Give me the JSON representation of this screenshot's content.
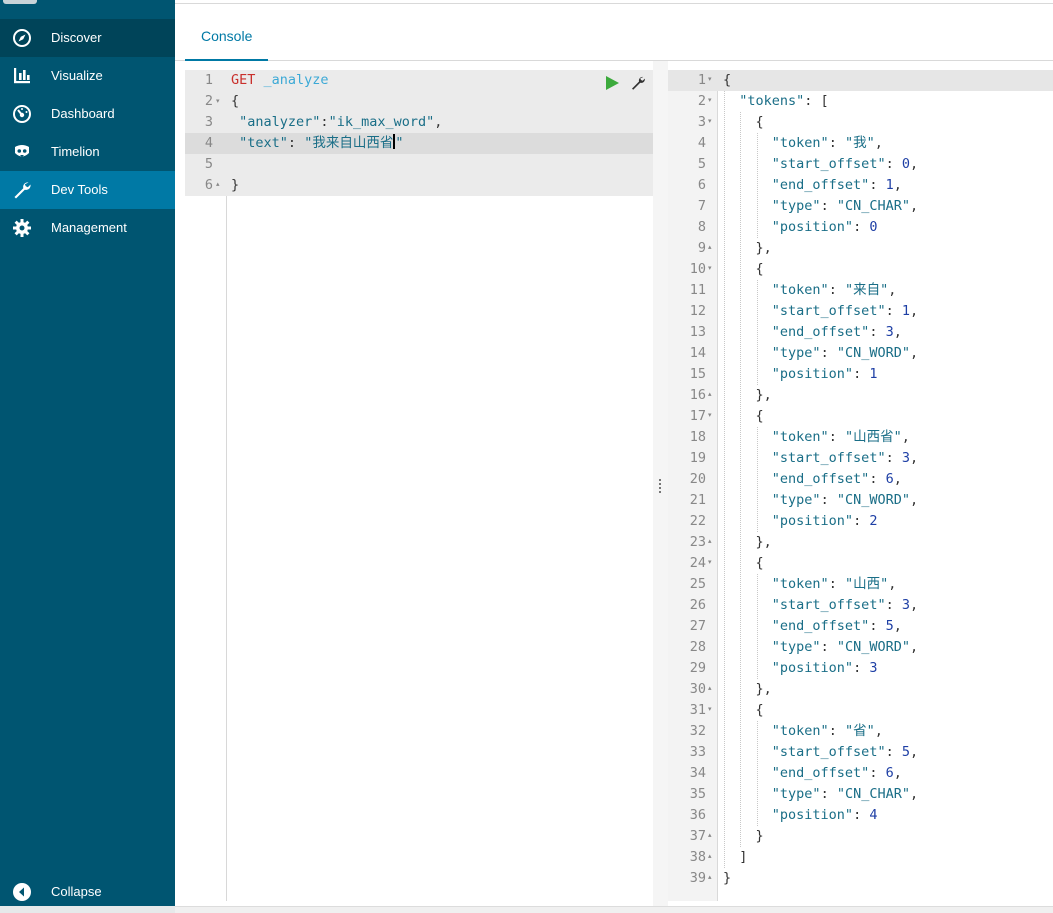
{
  "sidebar": {
    "items": [
      {
        "label": "Discover",
        "icon": "compass-icon"
      },
      {
        "label": "Visualize",
        "icon": "bar-chart-icon"
      },
      {
        "label": "Dashboard",
        "icon": "dashboard-gauge-icon"
      },
      {
        "label": "Timelion",
        "icon": "timelion-mask-icon"
      },
      {
        "label": "Dev Tools",
        "icon": "wrench-icon"
      },
      {
        "label": "Management",
        "icon": "gear-icon"
      }
    ],
    "collapse_label": "Collapse",
    "active_item": "Dev Tools",
    "colors": {
      "background": "#005571",
      "active": "#0079a5",
      "hover": "#004459"
    }
  },
  "tabs": {
    "console_label": "Console"
  },
  "request_editor": {
    "line_numbers": [
      "1",
      "2",
      "3",
      "4",
      "5",
      "6"
    ],
    "method": "GET",
    "url": "_analyze",
    "line2": "{",
    "line3_key": "\"analyzer\"",
    "line3_colon": ":",
    "line3_value": "\"ik_max_word\"",
    "line3_comma": ",",
    "line4_key": "\"text\"",
    "line4_colon": ": ",
    "line4_value": "\"我来自山西省",
    "line4_close": "\"",
    "line6": "}",
    "run_icon": "play-icon",
    "settings_icon": "wrench-icon"
  },
  "response": {
    "lines": [
      "{",
      "  \"tokens\": [",
      "    {",
      "      \"token\": \"我\",",
      "      \"start_offset\": 0,",
      "      \"end_offset\": 1,",
      "      \"type\": \"CN_CHAR\",",
      "      \"position\": 0",
      "    },",
      "    {",
      "      \"token\": \"来自\",",
      "      \"start_offset\": 1,",
      "      \"end_offset\": 3,",
      "      \"type\": \"CN_WORD\",",
      "      \"position\": 1",
      "    },",
      "    {",
      "      \"token\": \"山西省\",",
      "      \"start_offset\": 3,",
      "      \"end_offset\": 6,",
      "      \"type\": \"CN_WORD\",",
      "      \"position\": 2",
      "    },",
      "    {",
      "      \"token\": \"山西\",",
      "      \"start_offset\": 3,",
      "      \"end_offset\": 5,",
      "      \"type\": \"CN_WORD\",",
      "      \"position\": 3",
      "    },",
      "    {",
      "      \"token\": \"省\",",
      "      \"start_offset\": 5,",
      "      \"end_offset\": 6,",
      "      \"type\": \"CN_CHAR\",",
      "      \"position\": 4",
      "    }",
      "  ]",
      "}"
    ],
    "fold_open_lines": [
      1,
      2,
      3,
      10,
      17,
      24,
      31
    ],
    "fold_close_lines": [
      9,
      16,
      23,
      30,
      37,
      38,
      39
    ]
  }
}
